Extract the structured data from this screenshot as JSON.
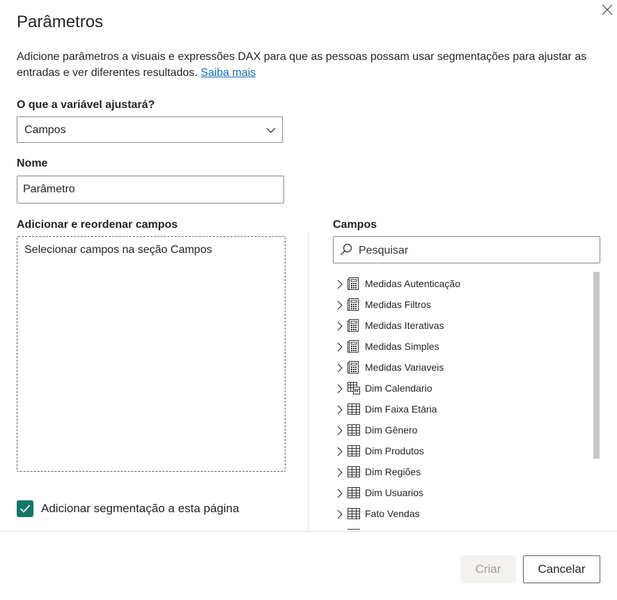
{
  "dialog": {
    "title": "Parâmetros",
    "description": "Adicione parâmetros a visuais e expressões DAX para que as pessoas possam usar segmentações para ajustar as entradas e ver diferentes resultados.",
    "learn_more": "Saiba mais"
  },
  "variable": {
    "label": "O que a variável ajustará?",
    "selected": "Campos"
  },
  "name": {
    "label": "Nome",
    "value": "Parâmetro"
  },
  "add_fields": {
    "label": "Adicionar e reordenar campos",
    "placeholder": "Selecionar campos na seção Campos"
  },
  "fields": {
    "label": "Campos",
    "search_placeholder": "Pesquisar",
    "items": [
      {
        "label": "Medidas Autenticação",
        "icon": "calculator-table-icon"
      },
      {
        "label": "Medidas Filtros",
        "icon": "calculator-table-icon"
      },
      {
        "label": "Medidas Iterativas",
        "icon": "calculator-table-icon"
      },
      {
        "label": "Medidas Simples",
        "icon": "calculator-table-icon"
      },
      {
        "label": "Medidas Variaveis",
        "icon": "calculator-table-icon"
      },
      {
        "label": "Dim Calendario",
        "icon": "date-table-icon"
      },
      {
        "label": "Dim Faixa Etária",
        "icon": "table-icon"
      },
      {
        "label": "Dim Gênero",
        "icon": "table-icon"
      },
      {
        "label": "Dim Produtos",
        "icon": "table-icon"
      },
      {
        "label": "Dim Regiões",
        "icon": "table-icon"
      },
      {
        "label": "Dim Usuarios",
        "icon": "table-icon"
      },
      {
        "label": "Fato Vendas",
        "icon": "table-icon"
      },
      {
        "label": "",
        "icon": "table-icon"
      }
    ]
  },
  "slicer_checkbox": {
    "label": "Adicionar segmentação a esta página",
    "checked": true
  },
  "footer": {
    "create_label": "Criar",
    "cancel_label": "Cancelar"
  },
  "colors": {
    "accent": "#117865",
    "link": "#0f6cbd",
    "text": "#252423",
    "border": "#8a8886"
  }
}
